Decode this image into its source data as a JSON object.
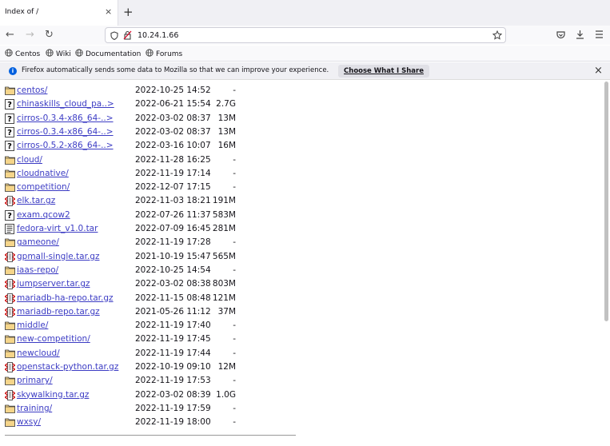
{
  "tab": {
    "title": "Index of /",
    "close": "×",
    "new": "+"
  },
  "nav": {
    "back": "←",
    "forward": "→",
    "reload": "↻",
    "url": "10.24.1.66"
  },
  "bookmarks": [
    "Centos",
    "Wiki",
    "Documentation",
    "Forums"
  ],
  "notification": {
    "text": "Firefox automatically sends some data to Mozilla so that we can improve your experience.",
    "button": "Choose What I Share",
    "close": "×"
  },
  "files": [
    {
      "name": "centos/",
      "date": "2022-10-25 14:52",
      "size": "-",
      "type": "folder"
    },
    {
      "name": "chinaskills_cloud_pa..>",
      "date": "2022-06-21 15:54",
      "size": "2.7G",
      "type": "unknown"
    },
    {
      "name": "cirros-0.3.4-x86_64-..>",
      "date": "2022-03-02 08:37",
      "size": "13M",
      "type": "unknown"
    },
    {
      "name": "cirros-0.3.4-x86_64-..>",
      "date": "2022-03-02 08:37",
      "size": "13M",
      "type": "unknown"
    },
    {
      "name": "cirros-0.5.2-x86_64-..>",
      "date": "2022-03-16 10:07",
      "size": "16M",
      "type": "unknown"
    },
    {
      "name": "cloud/",
      "date": "2022-11-28 16:25",
      "size": "-",
      "type": "folder"
    },
    {
      "name": "cloudnative/",
      "date": "2022-11-19 17:14",
      "size": "-",
      "type": "folder"
    },
    {
      "name": "competition/",
      "date": "2022-12-07 17:15",
      "size": "-",
      "type": "folder"
    },
    {
      "name": "elk.tar.gz",
      "date": "2022-11-03 18:21",
      "size": "191M",
      "type": "archive"
    },
    {
      "name": "exam.qcow2",
      "date": "2022-07-26 11:37",
      "size": "583M",
      "type": "unknown"
    },
    {
      "name": "fedora-virt_v1.0.tar",
      "date": "2022-07-09 16:45",
      "size": "281M",
      "type": "text"
    },
    {
      "name": "gameone/",
      "date": "2022-11-19 17:28",
      "size": "-",
      "type": "folder"
    },
    {
      "name": "gpmall-single.tar.gz",
      "date": "2021-10-19 15:47",
      "size": "565M",
      "type": "archive"
    },
    {
      "name": "iaas-repo/",
      "date": "2022-10-25 14:54",
      "size": "-",
      "type": "folder"
    },
    {
      "name": "jumpserver.tar.gz",
      "date": "2022-03-02 08:38",
      "size": "803M",
      "type": "archive"
    },
    {
      "name": "mariadb-ha-repo.tar.gz",
      "date": "2022-11-15 08:48",
      "size": "121M",
      "type": "archive"
    },
    {
      "name": "mariadb-repo.tar.gz",
      "date": "2021-05-26 11:12",
      "size": "37M",
      "type": "archive"
    },
    {
      "name": "middle/",
      "date": "2022-11-19 17:40",
      "size": "-",
      "type": "folder"
    },
    {
      "name": "new-competition/",
      "date": "2022-11-19 17:45",
      "size": "-",
      "type": "folder"
    },
    {
      "name": "newcloud/",
      "date": "2022-11-19 17:44",
      "size": "-",
      "type": "folder"
    },
    {
      "name": "openstack-python.tar.gz",
      "date": "2022-10-19 09:10",
      "size": "12M",
      "type": "archive"
    },
    {
      "name": "primary/",
      "date": "2022-11-19 17:53",
      "size": "-",
      "type": "folder"
    },
    {
      "name": "skywalking.tar.gz",
      "date": "2022-03-02 08:39",
      "size": "1.0G",
      "type": "archive"
    },
    {
      "name": "training/",
      "date": "2022-11-19 17:59",
      "size": "-",
      "type": "folder"
    },
    {
      "name": "wxsy/",
      "date": "2022-11-19 18:00",
      "size": "-",
      "type": "folder"
    }
  ]
}
